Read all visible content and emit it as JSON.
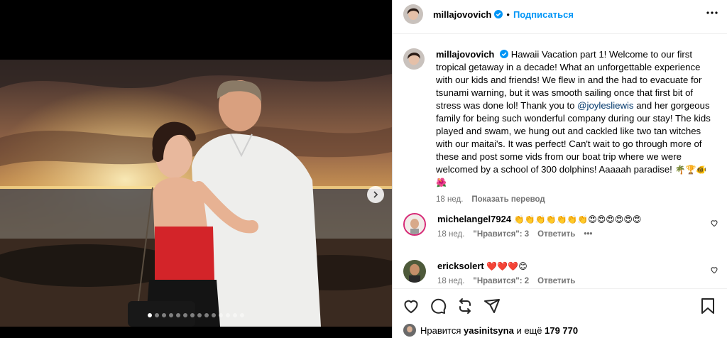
{
  "post": {
    "author": "millajovovich",
    "follow_label": "Подписаться",
    "separator": "•",
    "caption": "Hawaii Vacation part 1! Welcome to our first tropical getaway in a decade! What an unforgettable experience with our kids and friends! We flew in and the had to evacuate for tsunami warning, but it was smooth sailing once that first bit of stress was done lol! Thank you to",
    "caption_mention": "@joylesliewis",
    "caption_rest": "and her gorgeous family for being such wonderful company during our stay! The kids played and swam, we hung out and cackled like two tan witches with our maitai's. It was perfect! Can't wait to go through more of these and post some vids from our boat trip where we were welcomed by a school of 300 dolphins! Aaaaah paradise!",
    "caption_emojis": "🌴🏆🐠",
    "caption_flower": "🌺",
    "time": "18 нед.",
    "translate_label": "Показать перевод"
  },
  "comments": [
    {
      "user": "michelangel7924",
      "text": "👏👏👏👏👏👏👏😍😍😍😍😍😍",
      "time": "18 нед.",
      "likes": "\"Нравится\": 3",
      "reply": "Ответить",
      "more": "•••"
    },
    {
      "user": "ericksolert",
      "text": "❤️❤️❤️😊",
      "time": "18 нед.",
      "likes": "\"Нравится\": 2",
      "reply": "Ответить"
    }
  ],
  "likes": {
    "prefix": "Нравится",
    "user": "yasinitsyna",
    "middle": "и ещё",
    "count": "179 770"
  },
  "carousel": {
    "total_slides": 14,
    "active_index": 0
  },
  "colors": {
    "accent": "#0095f6",
    "mention": "#00376b",
    "verified": "#0095f6"
  }
}
